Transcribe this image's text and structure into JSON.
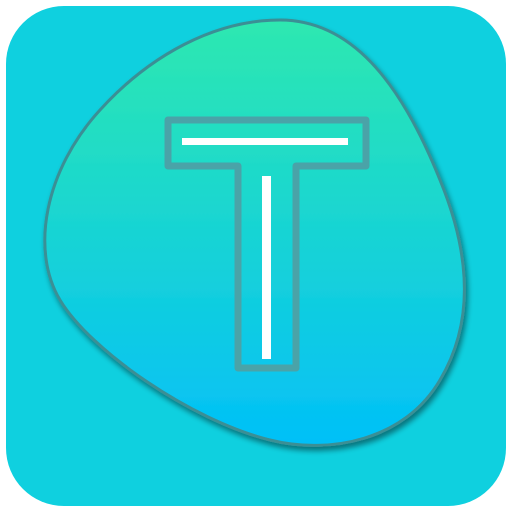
{
  "app_icon": {
    "icon": "letter-t-icon",
    "colors": {
      "tile": "#0fd0df",
      "blob_top": "#2ee8b0",
      "blob_bottom": "#02c0f8",
      "letter_outline": "#4aa3a8",
      "letter_inner_line": "#ffffff",
      "shadow": "#3a8f95"
    }
  }
}
